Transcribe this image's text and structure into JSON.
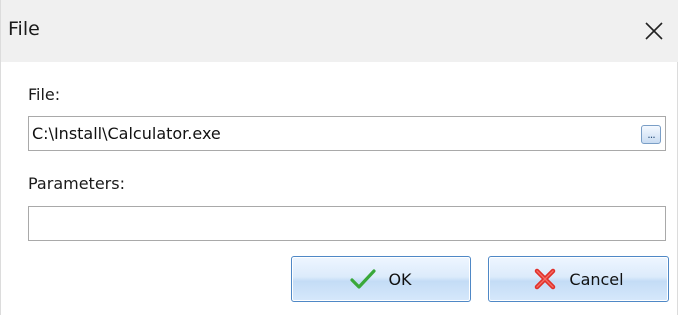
{
  "window": {
    "title": "File",
    "close_icon": "close-icon"
  },
  "form": {
    "file_label": "File:",
    "file_value": "C:\\Install\\Calculator.exe",
    "browse_label": "...",
    "params_label": "Parameters:",
    "params_value": ""
  },
  "buttons": {
    "ok_label": "OK",
    "ok_icon": "checkmark-icon",
    "cancel_label": "Cancel",
    "cancel_icon": "red-x-icon"
  },
  "colors": {
    "accent_border": "#4f88c6",
    "ok_icon": "#3aa83a",
    "cancel_icon": "#e0302a"
  }
}
